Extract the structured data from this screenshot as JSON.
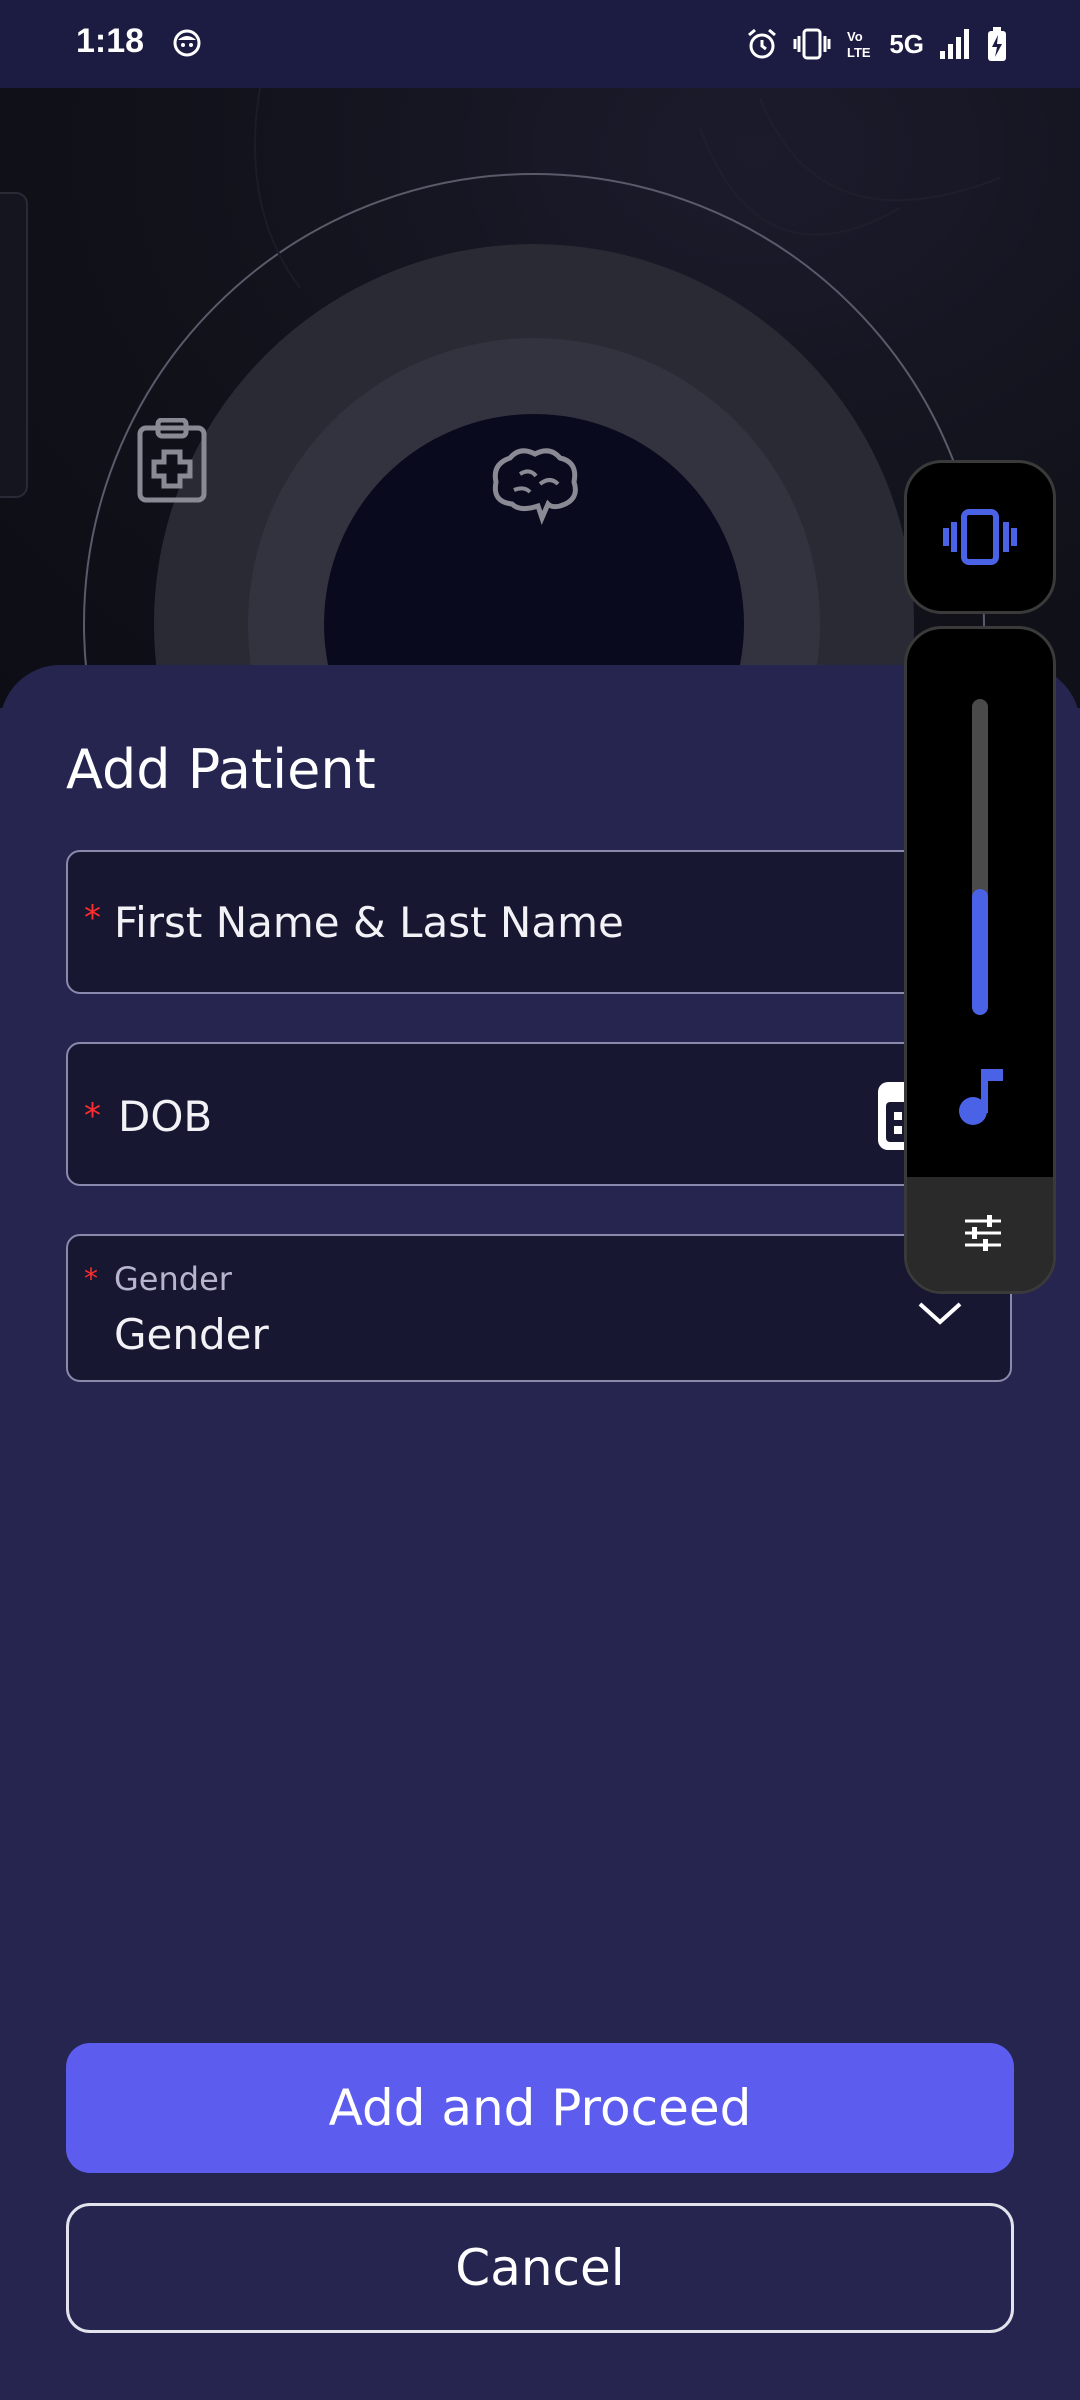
{
  "status_bar": {
    "time": "1:18",
    "network": "5G",
    "volte": "Vo LTE",
    "icons": [
      "face-icon",
      "alarm-icon",
      "vibrate-icon",
      "volte-icon",
      "signal-icon",
      "battery-charging-icon"
    ]
  },
  "hero": {
    "icons": [
      "clipboard-medical-icon",
      "brain-icon"
    ]
  },
  "form": {
    "title": "Add Patient",
    "name_field": {
      "required_mark": "*",
      "placeholder": "First Name & Last Name"
    },
    "dob_field": {
      "required_mark": "*",
      "placeholder": "DOB",
      "icon": "calendar-icon"
    },
    "gender_field": {
      "required_mark": "*",
      "label": "Gender",
      "value": "Gender",
      "icon": "chevron-down-icon"
    }
  },
  "actions": {
    "primary_label": "Add and Proceed",
    "secondary_label": "Cancel"
  },
  "volume_overlay": {
    "ringer_mode_icon": "vibrate-icon",
    "stream_icon": "music-icon",
    "settings_icon": "tune-icon",
    "level_fraction": 0.4
  },
  "colors": {
    "sheet_bg": "#262550",
    "status_bar_bg": "#1c1b42",
    "field_bg": "#171731",
    "primary_button": "#5c5cee",
    "required": "#ff2d2d",
    "volume_accent": "#4a63e6"
  }
}
